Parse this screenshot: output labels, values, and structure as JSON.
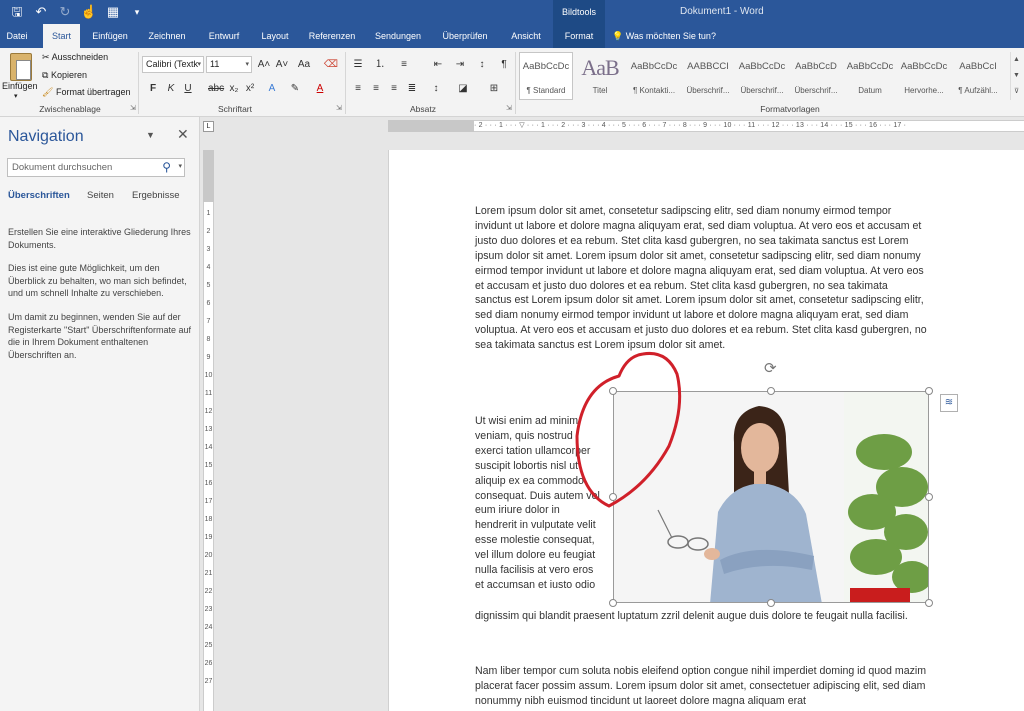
{
  "titlebar": {
    "context_tab": "Bildtools",
    "doc_title": "Dokument1  -  Word"
  },
  "tabs": [
    "Datei",
    "Start",
    "Einfügen",
    "Zeichnen",
    "Entwurf",
    "Layout",
    "Referenzen",
    "Sendungen",
    "Überprüfen",
    "Ansicht",
    "Format"
  ],
  "tell_me": "Was möchten Sie tun?",
  "ribbon": {
    "clipboard": {
      "paste": "Einfügen",
      "cut": "Ausschneiden",
      "copy": "Kopieren",
      "format_painter": "Format übertragen",
      "label": "Zwischenablage"
    },
    "font": {
      "family": "Calibri (Textk",
      "size": "11",
      "label": "Schriftart"
    },
    "paragraph": {
      "label": "Absatz"
    },
    "styles": {
      "label": "Formatvorlagen",
      "items": [
        {
          "sample": "AaBbCcDc",
          "name": "¶ Standard"
        },
        {
          "sample": "AaB",
          "name": "Titel"
        },
        {
          "sample": "AaBbCcDc",
          "name": "¶ Kontakti..."
        },
        {
          "sample": "AABBCCI",
          "name": "Überschrif..."
        },
        {
          "sample": "AaBbCcDc",
          "name": "Überschrif..."
        },
        {
          "sample": "AaBbCcD",
          "name": "Überschrif..."
        },
        {
          "sample": "AaBbCcDc",
          "name": "Datum"
        },
        {
          "sample": "AaBbCcDc",
          "name": "Hervorhe..."
        },
        {
          "sample": "AaBbCcI",
          "name": "¶ Aufzähl..."
        }
      ]
    }
  },
  "navigation": {
    "title": "Navigation",
    "search_placeholder": "Dokument durchsuchen",
    "tabs": [
      "Überschriften",
      "Seiten",
      "Ergebnisse"
    ],
    "paragraphs": [
      "Erstellen Sie eine interaktive Gliederung Ihres Dokuments.",
      "Dies ist eine gute Möglichkeit, um den Überblick zu behalten, wo man sich befindet, und um schnell Inhalte zu verschieben.",
      "Um damit zu beginnen, wenden Sie auf der Registerkarte \"Start\" Überschriftenformate auf die in Ihrem Dokument enthaltenen Überschriften an."
    ]
  },
  "ruler": {
    "h_marks": "· 2 · · · 1 · · · ▽ · · · 1 · · · 2 · · · 3 · · · 4 · · · 5 · · · 6 · · · 7 · · · 8 · · · 9 · · · 10 · · · 11 · · · 12 · · · 13 · · · 14 · · · 15 · · · 16 · · · 17 ·",
    "v_marks": [
      "1",
      "2",
      "3",
      "4",
      "5",
      "6",
      "7",
      "8",
      "9",
      "10",
      "11",
      "12",
      "13",
      "14",
      "15",
      "16",
      "17",
      "18",
      "19",
      "20",
      "21",
      "22",
      "23",
      "24",
      "25",
      "26",
      "27"
    ]
  },
  "document": {
    "p1": "Lorem ipsum dolor sit amet, consetetur sadipscing elitr, sed diam nonumy eirmod tempor invidunt ut labore et dolore magna aliquyam erat, sed diam voluptua. At vero eos et accusam et justo duo dolores et ea rebum. Stet clita kasd gubergren, no sea takimata sanctus est Lorem ipsum dolor sit amet. Lorem ipsum dolor sit amet, consetetur sadipscing elitr, sed diam nonumy eirmod tempor invidunt ut labore et dolore magna aliquyam erat, sed diam voluptua. At vero eos et accusam et justo duo dolores et ea rebum. Stet clita kasd gubergren, no sea takimata sanctus est Lorem ipsum dolor sit amet. Lorem ipsum dolor sit amet, consetetur sadipscing elitr, sed diam nonumy eirmod tempor invidunt ut labore et dolore magna aliquyam erat, sed diam voluptua. At vero eos et accusam et justo duo dolores et ea rebum. Stet clita kasd gubergren, no sea takimata sanctus est Lorem ipsum dolor sit amet.",
    "p2": "Ut wisi enim ad minim veniam, quis nostrud exerci tation ullamcorper suscipit lobortis nisl ut aliquip ex ea commodo consequat. Duis autem vel eum iriure dolor in hendrerit in vulputate velit esse molestie consequat, vel illum dolore eu feugiat nulla facilisis at vero eros et accumsan et iusto odio",
    "p3": "dignissim qui blandit praesent luptatum zzril delenit augue duis dolore te feugait nulla facilisi.",
    "p4": "Nam liber tempor cum soluta nobis eleifend option congue nihil imperdiet doming id quod mazim placerat facer possim assum. Lorem ipsum dolor sit amet, consectetuer adipiscing elit, sed diam nonummy nibh euismod tincidunt ut laoreet dolore magna aliquam erat"
  },
  "colors": {
    "brand": "#2b579a",
    "annotation": "#d0202a"
  }
}
